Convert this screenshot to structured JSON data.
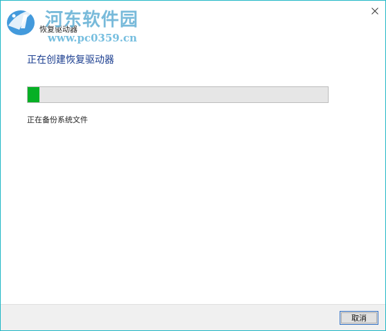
{
  "window": {
    "title": "恢复驱动器"
  },
  "watermark": {
    "title": "河东软件园",
    "url": "www.pc0359.cn"
  },
  "main": {
    "heading": "正在创建恢复驱动器",
    "progress_fraction": 0.04,
    "status": "正在备份系统文件"
  },
  "footer": {
    "cancel_label": "取消"
  },
  "colors": {
    "accent_border": "#1fb7c6",
    "heading": "#1a3d8f",
    "progress_fill": "#06b025"
  },
  "icons": {
    "close": "close-icon",
    "watermark_logo": "watermark-logo-icon"
  }
}
